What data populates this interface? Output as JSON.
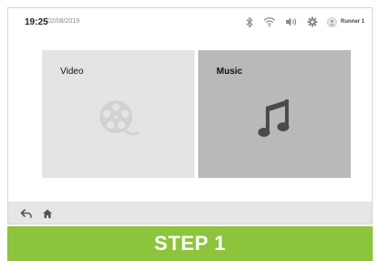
{
  "status": {
    "time": "19:25",
    "date": "02/08/2019",
    "user_name": "Runner 1",
    "icons": [
      "bluetooth-icon",
      "wifi-icon",
      "volume-icon",
      "settings-icon",
      "user-icon"
    ]
  },
  "tiles": [
    {
      "label": "Video",
      "icon": "film-reel-icon",
      "bg": "#e4e4e4",
      "selected": false
    },
    {
      "label": "Music",
      "icon": "music-note-icon",
      "bg": "#b9b9b9",
      "selected": true
    }
  ],
  "bottom_nav": {
    "icons": [
      "back-arrow-icon",
      "home-icon"
    ]
  },
  "banner": {
    "text": "STEP 1",
    "color": "#8cc43c"
  }
}
